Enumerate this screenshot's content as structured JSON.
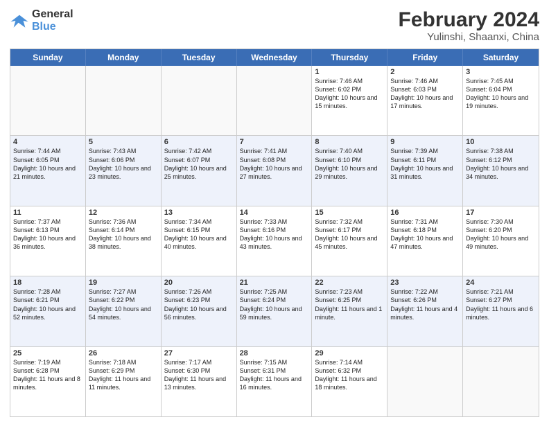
{
  "logo": {
    "general": "General",
    "blue": "Blue"
  },
  "title": {
    "month_year": "February 2024",
    "location": "Yulinshi, Shaanxi, China"
  },
  "header_days": [
    "Sunday",
    "Monday",
    "Tuesday",
    "Wednesday",
    "Thursday",
    "Friday",
    "Saturday"
  ],
  "rows": [
    {
      "alt": false,
      "cells": [
        {
          "day": "",
          "text": "",
          "empty": true
        },
        {
          "day": "",
          "text": "",
          "empty": true
        },
        {
          "day": "",
          "text": "",
          "empty": true
        },
        {
          "day": "",
          "text": "",
          "empty": true
        },
        {
          "day": "1",
          "text": "Sunrise: 7:46 AM\nSunset: 6:02 PM\nDaylight: 10 hours and 15 minutes.",
          "empty": false
        },
        {
          "day": "2",
          "text": "Sunrise: 7:46 AM\nSunset: 6:03 PM\nDaylight: 10 hours and 17 minutes.",
          "empty": false
        },
        {
          "day": "3",
          "text": "Sunrise: 7:45 AM\nSunset: 6:04 PM\nDaylight: 10 hours and 19 minutes.",
          "empty": false
        }
      ]
    },
    {
      "alt": true,
      "cells": [
        {
          "day": "4",
          "text": "Sunrise: 7:44 AM\nSunset: 6:05 PM\nDaylight: 10 hours and 21 minutes.",
          "empty": false
        },
        {
          "day": "5",
          "text": "Sunrise: 7:43 AM\nSunset: 6:06 PM\nDaylight: 10 hours and 23 minutes.",
          "empty": false
        },
        {
          "day": "6",
          "text": "Sunrise: 7:42 AM\nSunset: 6:07 PM\nDaylight: 10 hours and 25 minutes.",
          "empty": false
        },
        {
          "day": "7",
          "text": "Sunrise: 7:41 AM\nSunset: 6:08 PM\nDaylight: 10 hours and 27 minutes.",
          "empty": false
        },
        {
          "day": "8",
          "text": "Sunrise: 7:40 AM\nSunset: 6:10 PM\nDaylight: 10 hours and 29 minutes.",
          "empty": false
        },
        {
          "day": "9",
          "text": "Sunrise: 7:39 AM\nSunset: 6:11 PM\nDaylight: 10 hours and 31 minutes.",
          "empty": false
        },
        {
          "day": "10",
          "text": "Sunrise: 7:38 AM\nSunset: 6:12 PM\nDaylight: 10 hours and 34 minutes.",
          "empty": false
        }
      ]
    },
    {
      "alt": false,
      "cells": [
        {
          "day": "11",
          "text": "Sunrise: 7:37 AM\nSunset: 6:13 PM\nDaylight: 10 hours and 36 minutes.",
          "empty": false
        },
        {
          "day": "12",
          "text": "Sunrise: 7:36 AM\nSunset: 6:14 PM\nDaylight: 10 hours and 38 minutes.",
          "empty": false
        },
        {
          "day": "13",
          "text": "Sunrise: 7:34 AM\nSunset: 6:15 PM\nDaylight: 10 hours and 40 minutes.",
          "empty": false
        },
        {
          "day": "14",
          "text": "Sunrise: 7:33 AM\nSunset: 6:16 PM\nDaylight: 10 hours and 43 minutes.",
          "empty": false
        },
        {
          "day": "15",
          "text": "Sunrise: 7:32 AM\nSunset: 6:17 PM\nDaylight: 10 hours and 45 minutes.",
          "empty": false
        },
        {
          "day": "16",
          "text": "Sunrise: 7:31 AM\nSunset: 6:18 PM\nDaylight: 10 hours and 47 minutes.",
          "empty": false
        },
        {
          "day": "17",
          "text": "Sunrise: 7:30 AM\nSunset: 6:20 PM\nDaylight: 10 hours and 49 minutes.",
          "empty": false
        }
      ]
    },
    {
      "alt": true,
      "cells": [
        {
          "day": "18",
          "text": "Sunrise: 7:28 AM\nSunset: 6:21 PM\nDaylight: 10 hours and 52 minutes.",
          "empty": false
        },
        {
          "day": "19",
          "text": "Sunrise: 7:27 AM\nSunset: 6:22 PM\nDaylight: 10 hours and 54 minutes.",
          "empty": false
        },
        {
          "day": "20",
          "text": "Sunrise: 7:26 AM\nSunset: 6:23 PM\nDaylight: 10 hours and 56 minutes.",
          "empty": false
        },
        {
          "day": "21",
          "text": "Sunrise: 7:25 AM\nSunset: 6:24 PM\nDaylight: 10 hours and 59 minutes.",
          "empty": false
        },
        {
          "day": "22",
          "text": "Sunrise: 7:23 AM\nSunset: 6:25 PM\nDaylight: 11 hours and 1 minute.",
          "empty": false
        },
        {
          "day": "23",
          "text": "Sunrise: 7:22 AM\nSunset: 6:26 PM\nDaylight: 11 hours and 4 minutes.",
          "empty": false
        },
        {
          "day": "24",
          "text": "Sunrise: 7:21 AM\nSunset: 6:27 PM\nDaylight: 11 hours and 6 minutes.",
          "empty": false
        }
      ]
    },
    {
      "alt": false,
      "cells": [
        {
          "day": "25",
          "text": "Sunrise: 7:19 AM\nSunset: 6:28 PM\nDaylight: 11 hours and 8 minutes.",
          "empty": false
        },
        {
          "day": "26",
          "text": "Sunrise: 7:18 AM\nSunset: 6:29 PM\nDaylight: 11 hours and 11 minutes.",
          "empty": false
        },
        {
          "day": "27",
          "text": "Sunrise: 7:17 AM\nSunset: 6:30 PM\nDaylight: 11 hours and 13 minutes.",
          "empty": false
        },
        {
          "day": "28",
          "text": "Sunrise: 7:15 AM\nSunset: 6:31 PM\nDaylight: 11 hours and 16 minutes.",
          "empty": false
        },
        {
          "day": "29",
          "text": "Sunrise: 7:14 AM\nSunset: 6:32 PM\nDaylight: 11 hours and 18 minutes.",
          "empty": false
        },
        {
          "day": "",
          "text": "",
          "empty": true
        },
        {
          "day": "",
          "text": "",
          "empty": true
        }
      ]
    }
  ]
}
